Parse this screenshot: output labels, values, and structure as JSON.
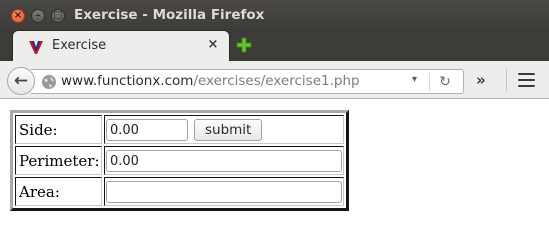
{
  "window": {
    "title": "Exercise - Mozilla Firefox",
    "close_glyph": "×",
    "min_glyph": "–",
    "max_glyph": "□"
  },
  "tabs": [
    {
      "label": "Exercise",
      "close_glyph": "×",
      "favicon": "fx-v-icon"
    }
  ],
  "nav": {
    "back_glyph": "←",
    "url_host": "www.functionx.com",
    "url_path": "/exercises/exercise1.php",
    "dropdown_glyph": "▾",
    "reload_glyph": "↻",
    "overflow_glyph": "»"
  },
  "form": {
    "side": {
      "label": "Side:",
      "value": "0.00"
    },
    "submit_label": "submit",
    "perimeter": {
      "label": "Perimeter:",
      "value": "0.00"
    },
    "area": {
      "label": "Area:",
      "value": ""
    }
  },
  "colors": {
    "titlebar": "#3c3b37",
    "close_button": "#e0532b",
    "newtab_plus": "#5bb02c"
  }
}
